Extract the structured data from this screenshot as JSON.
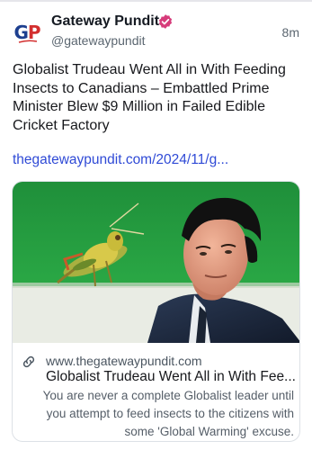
{
  "post": {
    "author": {
      "display_name": "Gateway Pundit",
      "handle": "@gatewaypundit",
      "avatar_text_1": "G",
      "avatar_text_2": "P",
      "avatar_icon": "gateway-pundit-logo",
      "verified_icon": "verified-badge-icon",
      "verified_color": "#d63b7a"
    },
    "time": "8m",
    "text": "Globalist Trudeau Went All in With Feeding Insects to Canadians – Embattled Prime Minister Blew $9 Million in Failed Edible Cricket Factory",
    "link_text": "thegatewaypundit.com/2024/11/g...",
    "link_color": "#2f4ad6"
  },
  "card": {
    "image_icon": "grasshopper-and-trudeau-image",
    "domain_icon": "link-icon",
    "domain": "www.thegatewaypundit.com",
    "title": "Globalist Trudeau Went All in With Fee...",
    "description": "You are never a complete Globalist leader until you attempt to feed insects to the citizens with some 'Global Warming' excuse."
  }
}
